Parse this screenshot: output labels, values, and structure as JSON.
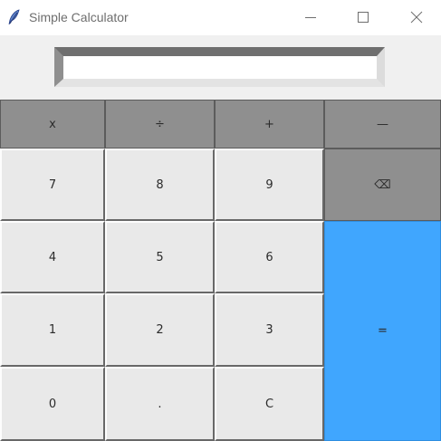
{
  "window": {
    "title": "Simple Calculator",
    "icon": "feather-icon"
  },
  "window_controls": {
    "minimize": "minimize-icon",
    "maximize": "maximize-icon",
    "close": "close-icon"
  },
  "display": {
    "value": ""
  },
  "keys": {
    "multiply": "x",
    "divide": "÷",
    "add": "+",
    "subtract": "—",
    "seven": "7",
    "eight": "8",
    "nine": "9",
    "backspace": "⌫",
    "four": "4",
    "five": "5",
    "six": "6",
    "one": "1",
    "two": "2",
    "three": "3",
    "equals": "=",
    "zero": "0",
    "dot": ".",
    "clear": "C"
  },
  "colors": {
    "operator": "#8f8f8f",
    "number": "#e9e9e9",
    "equals": "#40a6fe"
  }
}
